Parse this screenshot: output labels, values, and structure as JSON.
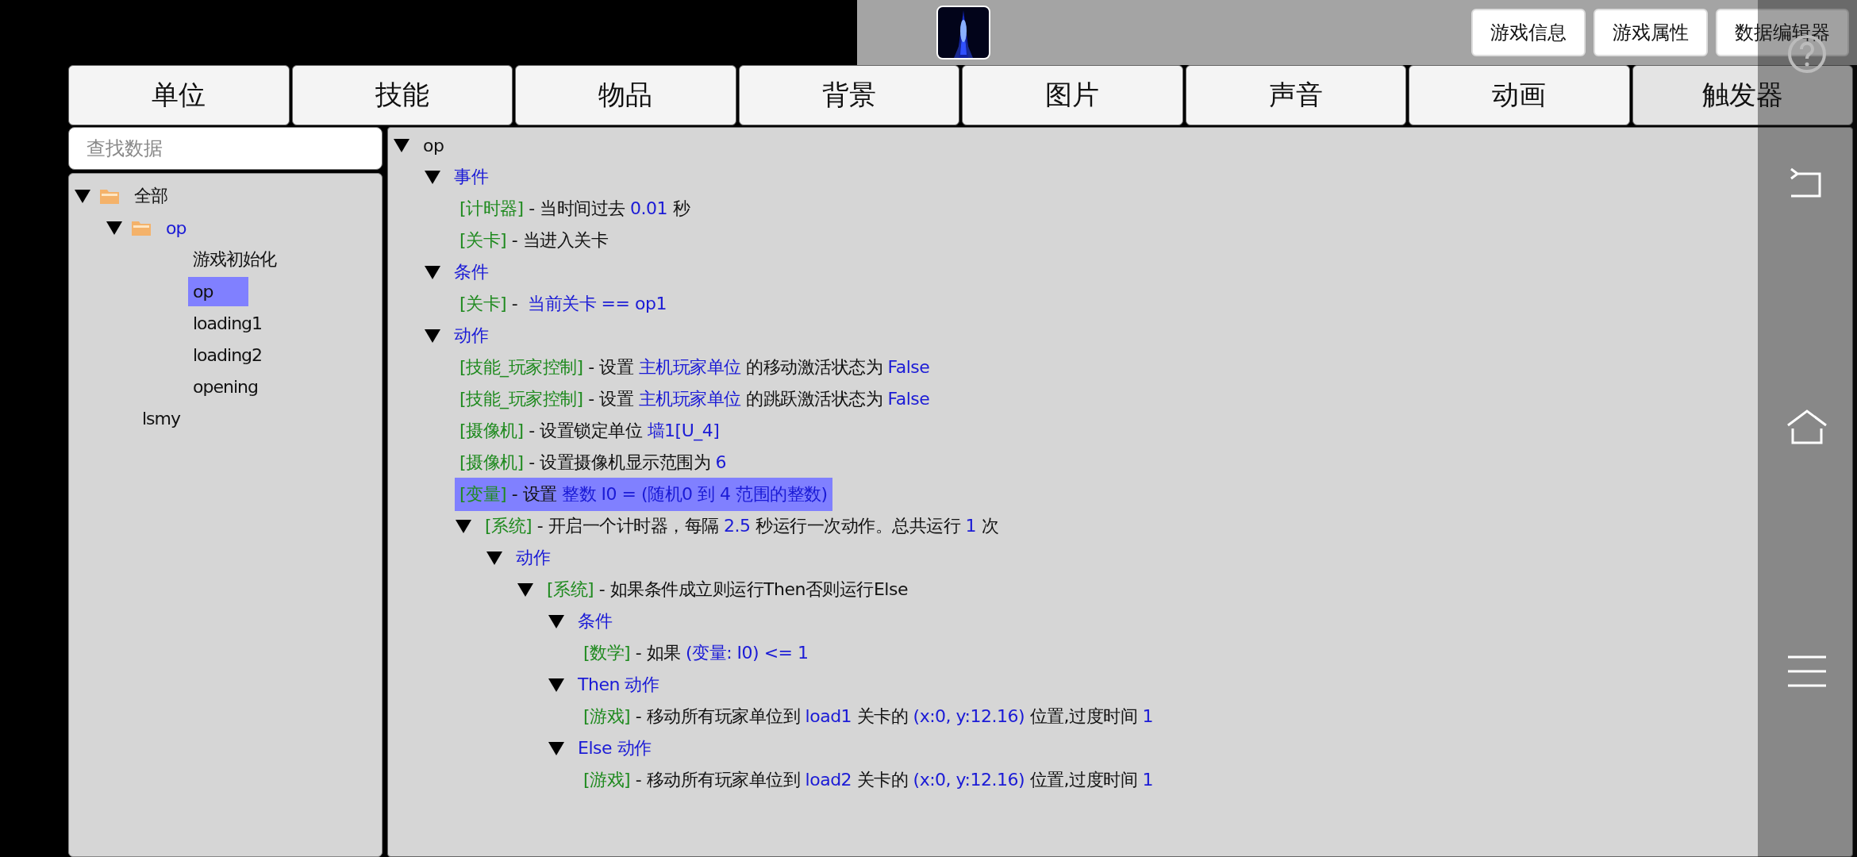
{
  "top_bar": {
    "thumbnail": {
      "kind": "picture"
    },
    "buttons": [
      "游戏信息",
      "游戏属性",
      "数据编辑器"
    ]
  },
  "tabs": [
    {
      "label": "单位",
      "selected": false
    },
    {
      "label": "技能",
      "selected": false
    },
    {
      "label": "物品",
      "selected": false
    },
    {
      "label": "背景",
      "selected": false
    },
    {
      "label": "图片",
      "selected": false
    },
    {
      "label": "声音",
      "selected": false
    },
    {
      "label": "动画",
      "selected": false
    },
    {
      "label": "触发器",
      "selected": true
    }
  ],
  "search": {
    "placeholder": "查找数据"
  },
  "sidebar": {
    "items": [
      {
        "label": "全部",
        "kind": "folder",
        "expanded": true,
        "selected": false,
        "children": [
          {
            "label": "op",
            "kind": "folder",
            "expanded": true,
            "selected": false,
            "children": [
              {
                "label": "游戏初始化",
                "kind": "item",
                "selected": false
              },
              {
                "label": "op",
                "kind": "item",
                "selected": true
              },
              {
                "label": "loading1",
                "kind": "item",
                "selected": false
              },
              {
                "label": "loading2",
                "kind": "item",
                "selected": false
              },
              {
                "label": "opening",
                "kind": "item",
                "selected": false
              }
            ]
          },
          {
            "label": "lsmy",
            "kind": "item",
            "selected": false
          }
        ]
      }
    ]
  },
  "trigger": {
    "nodes": [
      {
        "expanded": true,
        "selected": false,
        "parts": [
          {
            "kind": "text",
            "text": "op"
          }
        ],
        "children": [
          {
            "expanded": true,
            "selected": false,
            "parts": [
              {
                "kind": "value",
                "text": "事件"
              }
            ],
            "children": [
              {
                "selected": false,
                "parts": [
                  {
                    "kind": "tag",
                    "text": "[计时器]"
                  },
                  {
                    "kind": "text",
                    "text": " - 当时间过去 "
                  },
                  {
                    "kind": "value",
                    "text": "0.01"
                  },
                  {
                    "kind": "text",
                    "text": " 秒"
                  }
                ]
              },
              {
                "selected": false,
                "parts": [
                  {
                    "kind": "tag",
                    "text": "[关卡]"
                  },
                  {
                    "kind": "text",
                    "text": " - 当进入关卡"
                  }
                ]
              }
            ]
          },
          {
            "expanded": true,
            "selected": false,
            "parts": [
              {
                "kind": "value",
                "text": "条件"
              }
            ],
            "children": [
              {
                "selected": false,
                "parts": [
                  {
                    "kind": "tag",
                    "text": "[关卡]"
                  },
                  {
                    "kind": "text",
                    "text": " - "
                  },
                  {
                    "kind": "value",
                    "text": " 当前关卡 == op1"
                  }
                ]
              }
            ]
          },
          {
            "expanded": true,
            "selected": false,
            "parts": [
              {
                "kind": "value",
                "text": "动作"
              }
            ],
            "children": [
              {
                "selected": false,
                "parts": [
                  {
                    "kind": "tag",
                    "text": "[技能_玩家控制]"
                  },
                  {
                    "kind": "text",
                    "text": " - 设置 "
                  },
                  {
                    "kind": "value",
                    "text": "主机玩家单位"
                  },
                  {
                    "kind": "text",
                    "text": " 的移动激活状态为 "
                  },
                  {
                    "kind": "value",
                    "text": "False"
                  }
                ]
              },
              {
                "selected": false,
                "parts": [
                  {
                    "kind": "tag",
                    "text": "[技能_玩家控制]"
                  },
                  {
                    "kind": "text",
                    "text": " - 设置 "
                  },
                  {
                    "kind": "value",
                    "text": "主机玩家单位"
                  },
                  {
                    "kind": "text",
                    "text": " 的跳跃激活状态为 "
                  },
                  {
                    "kind": "value",
                    "text": "False"
                  }
                ]
              },
              {
                "selected": false,
                "parts": [
                  {
                    "kind": "tag",
                    "text": "[摄像机]"
                  },
                  {
                    "kind": "text",
                    "text": " - 设置锁定单位 "
                  },
                  {
                    "kind": "value",
                    "text": "墙1[U_4]"
                  }
                ]
              },
              {
                "selected": false,
                "parts": [
                  {
                    "kind": "tag",
                    "text": "[摄像机]"
                  },
                  {
                    "kind": "text",
                    "text": " - 设置摄像机显示范围为 "
                  },
                  {
                    "kind": "value",
                    "text": "6"
                  }
                ]
              },
              {
                "selected": true,
                "parts": [
                  {
                    "kind": "tag",
                    "text": "[变量]"
                  },
                  {
                    "kind": "text",
                    "text": " - 设置 "
                  },
                  {
                    "kind": "value",
                    "text": "整数 I0 = (随机0 到 4 范围的整数)"
                  }
                ]
              },
              {
                "expanded": true,
                "selected": false,
                "parts": [
                  {
                    "kind": "tag",
                    "text": "[系统]"
                  },
                  {
                    "kind": "text",
                    "text": " - 开启一个计时器，每隔 "
                  },
                  {
                    "kind": "value",
                    "text": "2.5"
                  },
                  {
                    "kind": "text",
                    "text": " 秒运行一次动作。总共运行 "
                  },
                  {
                    "kind": "value",
                    "text": "1"
                  },
                  {
                    "kind": "text",
                    "text": " 次"
                  }
                ],
                "children": [
                  {
                    "expanded": true,
                    "selected": false,
                    "parts": [
                      {
                        "kind": "value",
                        "text": "动作"
                      }
                    ],
                    "children": [
                      {
                        "expanded": true,
                        "selected": false,
                        "parts": [
                          {
                            "kind": "tag",
                            "text": "[系统]"
                          },
                          {
                            "kind": "text",
                            "text": " - 如果条件成立则运行Then否则运行Else"
                          }
                        ],
                        "children": [
                          {
                            "expanded": true,
                            "selected": false,
                            "parts": [
                              {
                                "kind": "value",
                                "text": "条件"
                              }
                            ],
                            "children": [
                              {
                                "selected": false,
                                "parts": [
                                  {
                                    "kind": "tag",
                                    "text": "[数学]"
                                  },
                                  {
                                    "kind": "text",
                                    "text": " - 如果 "
                                  },
                                  {
                                    "kind": "value",
                                    "text": "(变量: I0) <= 1"
                                  }
                                ]
                              }
                            ]
                          },
                          {
                            "expanded": true,
                            "selected": false,
                            "parts": [
                              {
                                "kind": "value",
                                "text": "Then 动作"
                              }
                            ],
                            "children": [
                              {
                                "selected": false,
                                "parts": [
                                  {
                                    "kind": "tag",
                                    "text": "[游戏]"
                                  },
                                  {
                                    "kind": "text",
                                    "text": " - 移动所有玩家单位到 "
                                  },
                                  {
                                    "kind": "value",
                                    "text": "load1"
                                  },
                                  {
                                    "kind": "text",
                                    "text": " 关卡的 "
                                  },
                                  {
                                    "kind": "value",
                                    "text": "(x:0, y:12.16)"
                                  },
                                  {
                                    "kind": "text",
                                    "text": " 位置,过度时间 "
                                  },
                                  {
                                    "kind": "value",
                                    "text": "1"
                                  }
                                ]
                              }
                            ]
                          },
                          {
                            "expanded": true,
                            "selected": false,
                            "parts": [
                              {
                                "kind": "value",
                                "text": "Else 动作"
                              }
                            ],
                            "children": [
                              {
                                "selected": false,
                                "parts": [
                                  {
                                    "kind": "tag",
                                    "text": "[游戏]"
                                  },
                                  {
                                    "kind": "text",
                                    "text": " - 移动所有玩家单位到 "
                                  },
                                  {
                                    "kind": "value",
                                    "text": "load2"
                                  },
                                  {
                                    "kind": "text",
                                    "text": " 关卡的 "
                                  },
                                  {
                                    "kind": "value",
                                    "text": "(x:0, y:12.16)"
                                  },
                                  {
                                    "kind": "text",
                                    "text": " 位置,过度时间 "
                                  },
                                  {
                                    "kind": "value",
                                    "text": "1"
                                  }
                                ]
                              }
                            ]
                          }
                        ]
                      }
                    ]
                  }
                ]
              }
            ]
          }
        ]
      }
    ]
  }
}
